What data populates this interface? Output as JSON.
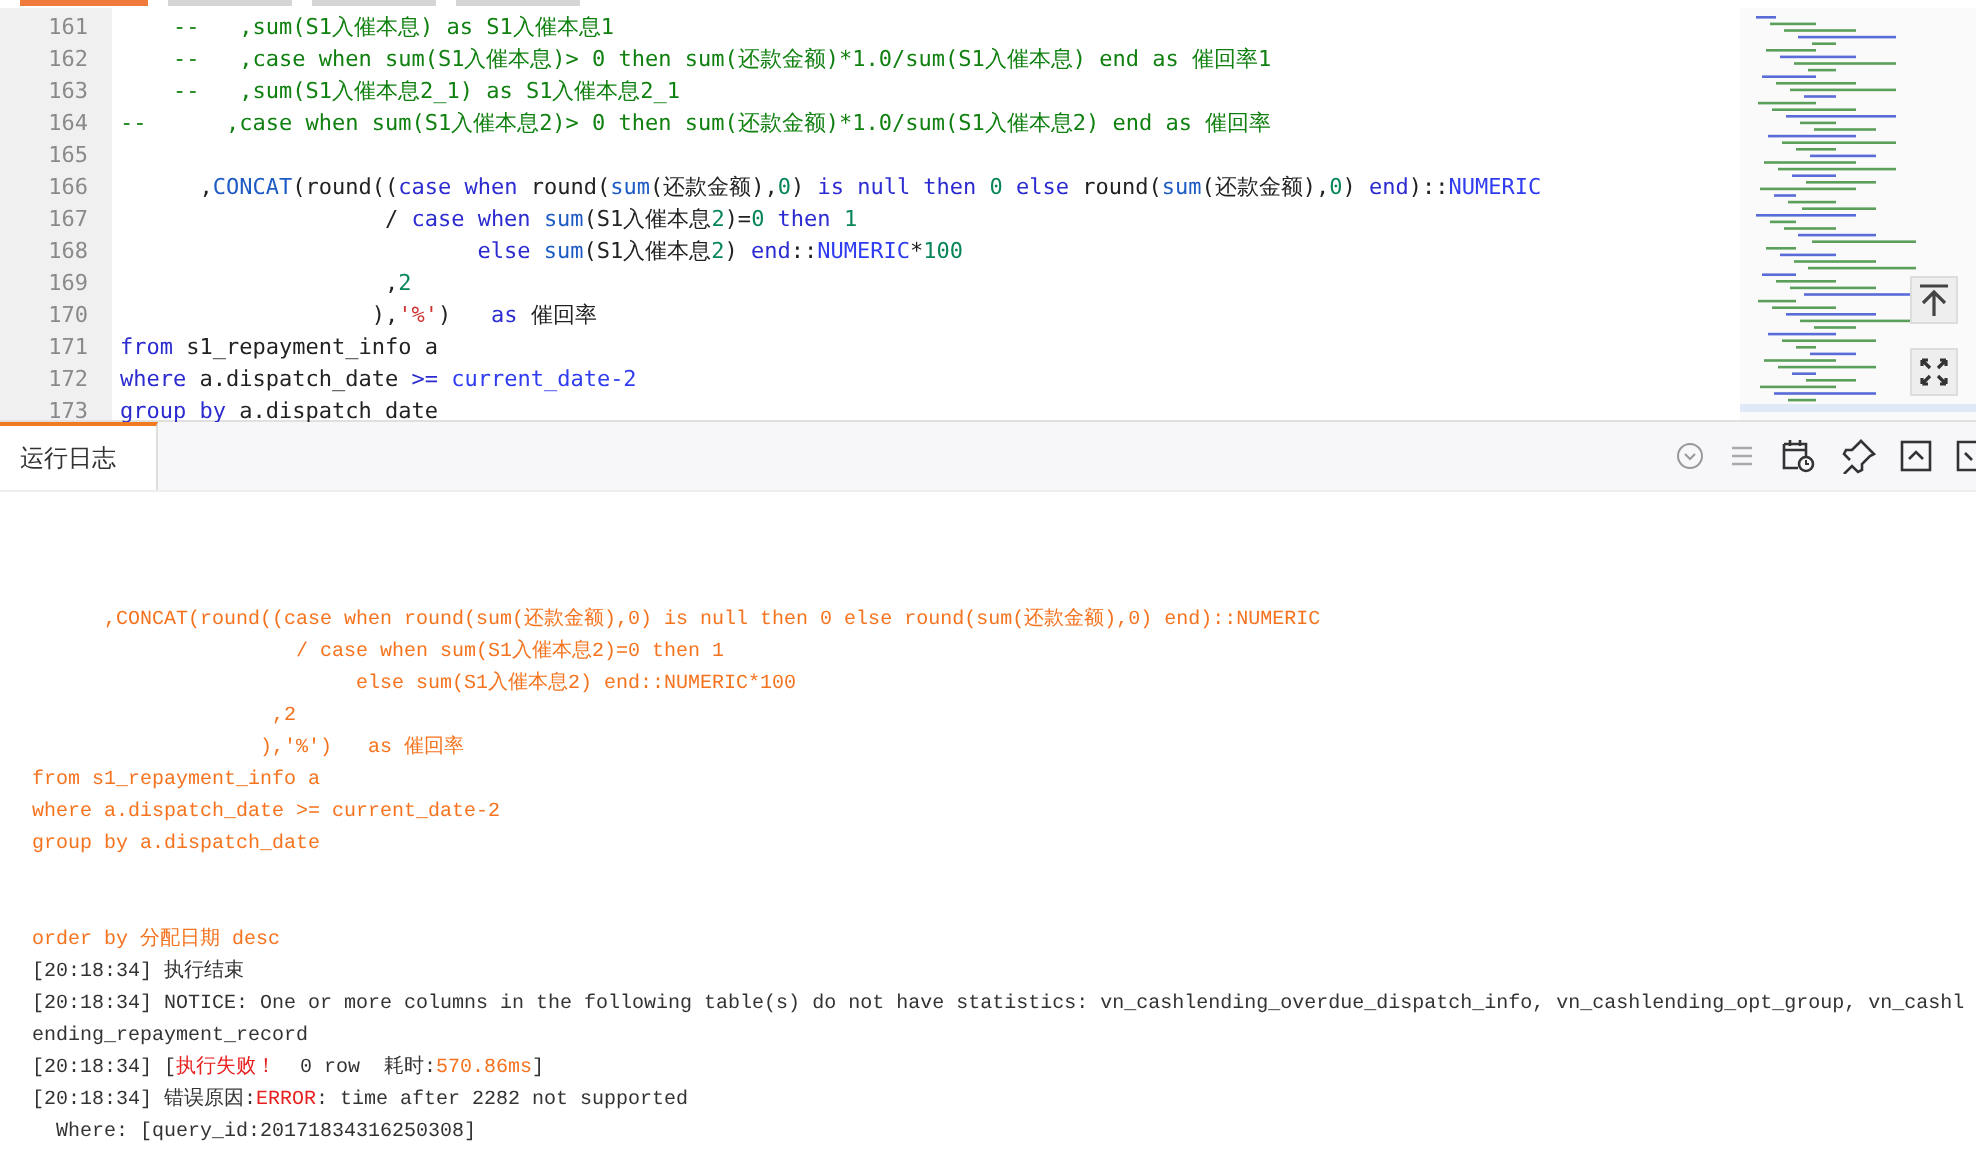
{
  "editor": {
    "tabs": [
      {
        "selected": true
      },
      {
        "selected": false
      },
      {
        "selected": false
      },
      {
        "selected": false
      }
    ],
    "lines": [
      {
        "number": "161",
        "tokens": [
          {
            "kind": "comment",
            "text": "    --   ,sum(S1入催本息) as S1入催本息1"
          }
        ]
      },
      {
        "number": "162",
        "tokens": [
          {
            "kind": "comment",
            "text": "    --   ,case when sum(S1入催本息)> 0 then sum(还款金额)*1.0/sum(S1入催本息) end as 催回率1"
          }
        ]
      },
      {
        "number": "163",
        "tokens": [
          {
            "kind": "comment",
            "text": "    --   ,sum(S1入催本息2_1) as S1入催本息2_1"
          }
        ]
      },
      {
        "number": "164",
        "tokens": [
          {
            "kind": "comment",
            "text": "--      ,case when sum(S1入催本息2)> 0 then sum(还款金额)*1.0/sum(S1入催本息2) end as 催回率"
          }
        ]
      },
      {
        "number": "165"
      },
      {
        "number": "166",
        "tokens": [
          {
            "kind": "plain",
            "text": "      ,"
          },
          {
            "kind": "fn",
            "text": "CONCAT"
          },
          {
            "kind": "plain",
            "text": "(round(("
          },
          {
            "kind": "kw",
            "text": "case when "
          },
          {
            "kind": "plain",
            "text": "round("
          },
          {
            "kind": "fn",
            "text": "sum"
          },
          {
            "kind": "plain",
            "text": "(还款金额),"
          },
          {
            "kind": "num",
            "text": "0"
          },
          {
            "kind": "plain",
            "text": ") "
          },
          {
            "kind": "kw",
            "text": "is null then "
          },
          {
            "kind": "num",
            "text": "0"
          },
          {
            "kind": "kw",
            "text": " else "
          },
          {
            "kind": "plain",
            "text": "round("
          },
          {
            "kind": "fn",
            "text": "sum"
          },
          {
            "kind": "plain",
            "text": "(还款金额),"
          },
          {
            "kind": "num",
            "text": "0"
          },
          {
            "kind": "plain",
            "text": ") "
          },
          {
            "kind": "kw",
            "text": "end"
          },
          {
            "kind": "plain",
            "text": ")::"
          },
          {
            "kind": "type",
            "text": "NUMERIC"
          }
        ]
      },
      {
        "number": "167",
        "tokens": [
          {
            "kind": "plain",
            "text": "                    / "
          },
          {
            "kind": "kw",
            "text": "case when "
          },
          {
            "kind": "fn",
            "text": "sum"
          },
          {
            "kind": "plain",
            "text": "(S1入催本息"
          },
          {
            "kind": "num",
            "text": "2"
          },
          {
            "kind": "plain",
            "text": ")="
          },
          {
            "kind": "num",
            "text": "0"
          },
          {
            "kind": "kw",
            "text": " then "
          },
          {
            "kind": "num",
            "text": "1"
          }
        ]
      },
      {
        "number": "168",
        "tokens": [
          {
            "kind": "kw",
            "text": "                           else "
          },
          {
            "kind": "fn",
            "text": "sum"
          },
          {
            "kind": "plain",
            "text": "(S1入催本息"
          },
          {
            "kind": "num",
            "text": "2"
          },
          {
            "kind": "plain",
            "text": ") "
          },
          {
            "kind": "kw",
            "text": "end"
          },
          {
            "kind": "plain",
            "text": "::"
          },
          {
            "kind": "type",
            "text": "NUMERIC"
          },
          {
            "kind": "plain",
            "text": "*"
          },
          {
            "kind": "num",
            "text": "100"
          }
        ]
      },
      {
        "number": "169",
        "tokens": [
          {
            "kind": "plain",
            "text": "                    ,"
          },
          {
            "kind": "num",
            "text": "2"
          }
        ]
      },
      {
        "number": "170",
        "tokens": [
          {
            "kind": "plain",
            "text": "                   ),"
          },
          {
            "kind": "str",
            "text": "'%'"
          },
          {
            "kind": "plain",
            "text": ")   "
          },
          {
            "kind": "kw",
            "text": "as "
          },
          {
            "kind": "plain",
            "text": "催回率"
          }
        ]
      },
      {
        "number": "171",
        "tokens": [
          {
            "kind": "kw",
            "text": "from "
          },
          {
            "kind": "plain",
            "text": "s1_repayment_info a"
          }
        ]
      },
      {
        "number": "172",
        "tokens": [
          {
            "kind": "kw",
            "text": "where "
          },
          {
            "kind": "plain",
            "text": "a.dispatch_date "
          },
          {
            "kind": "kw",
            "text": ">= "
          },
          {
            "kind": "type",
            "text": "current_date-2"
          }
        ]
      },
      {
        "number": "173",
        "tokens": [
          {
            "kind": "kw",
            "text": "group by "
          },
          {
            "kind": "plain",
            "text": "a.dispatch_date"
          }
        ]
      }
    ]
  },
  "log": {
    "tab": {
      "label": "运行日志",
      "selected": true
    },
    "sql_lines": [
      "      ,CONCAT(round((case when round(sum(还款金额),0) is null then 0 else round(sum(还款金额),0) end)::NUMERIC",
      "                      / case when sum(S1入催本息2)=0 then 1",
      "                           else sum(S1入催本息2) end::NUMERIC*100",
      "                    ,2",
      "                   ),'%')   as 催回率",
      "from s1_repayment_info a",
      "where a.dispatch_date >= current_date-2",
      "group by a.dispatch_date"
    ],
    "sql_tail": "order by 分配日期 desc",
    "entries": [
      [
        {
          "kind": "plain",
          "text": "[20:18:34] 执行结束"
        }
      ],
      [
        {
          "kind": "plain",
          "text": "[20:18:34] NOTICE: One or more columns in the following table(s) do not have statistics: vn_cashlending_overdue_dispatch_info, vn_cashlending_opt_group, vn_cashlending_repayment_record"
        }
      ],
      [
        {
          "kind": "plain",
          "text": "[20:18:34] ["
        },
        {
          "kind": "error",
          "text": "执行失败！"
        },
        {
          "kind": "plain",
          "text": "  0 row  耗时:"
        },
        {
          "kind": "highlight",
          "text": "570.86ms"
        },
        {
          "kind": "plain",
          "text": "]"
        }
      ],
      [
        {
          "kind": "plain",
          "text": "[20:18:34] 错误原因:"
        },
        {
          "kind": "error",
          "text": "ERROR"
        },
        {
          "kind": "plain",
          "text": ": time after 2282 not supported"
        }
      ],
      [
        {
          "kind": "plain",
          "text": "  Where: [query_id:20171834316250308]"
        }
      ]
    ]
  }
}
